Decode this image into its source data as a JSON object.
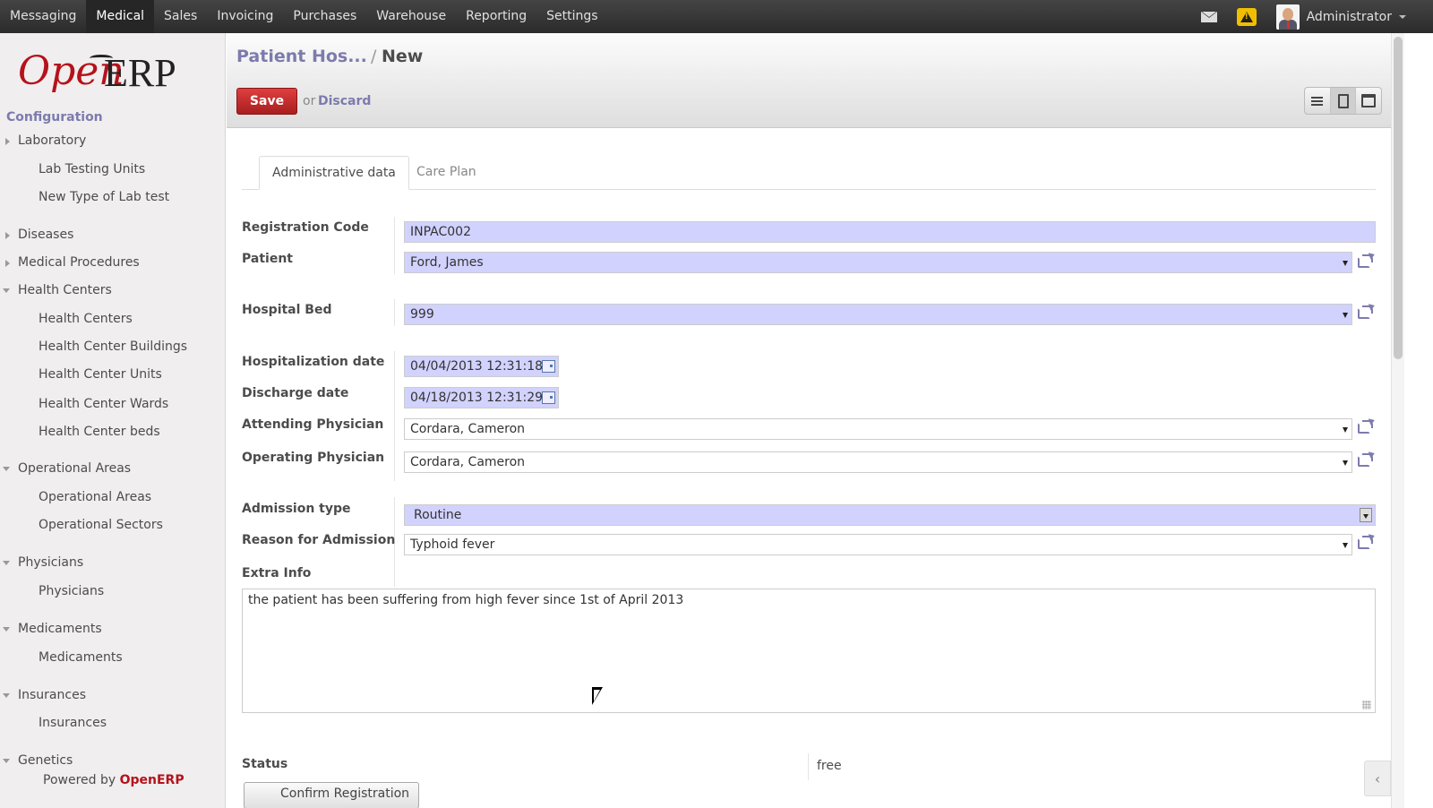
{
  "topmenu": {
    "items": [
      "Messaging",
      "Medical",
      "Sales",
      "Invoicing",
      "Purchases",
      "Warehouse",
      "Reporting",
      "Settings"
    ],
    "active": "Medical",
    "user": "Administrator"
  },
  "logo": {
    "part1": "Open",
    "part2": "ERP"
  },
  "sidebar": {
    "section": "Configuration",
    "items": [
      {
        "label": "Laboratory",
        "level": 1,
        "arrow": "right"
      },
      {
        "label": "Lab Testing Units",
        "level": 2
      },
      {
        "label": "New Type of Lab test",
        "level": 2
      },
      {
        "label": "Diseases",
        "level": 1,
        "arrow": "right"
      },
      {
        "label": "Medical Procedures",
        "level": 1,
        "arrow": "right"
      },
      {
        "label": "Health Centers",
        "level": 1,
        "arrow": "down"
      },
      {
        "label": "Health Centers",
        "level": 2
      },
      {
        "label": "Health Center Buildings",
        "level": 2
      },
      {
        "label": "Health Center Units",
        "level": 2
      },
      {
        "label": "Health Center Wards",
        "level": 2
      },
      {
        "label": "Health Center beds",
        "level": 2
      },
      {
        "label": "Operational Areas",
        "level": 1,
        "arrow": "down"
      },
      {
        "label": "Operational Areas",
        "level": 2
      },
      {
        "label": "Operational Sectors",
        "level": 2
      },
      {
        "label": "Physicians",
        "level": 1,
        "arrow": "down"
      },
      {
        "label": "Physicians",
        "level": 2
      },
      {
        "label": "Medicaments",
        "level": 1,
        "arrow": "down"
      },
      {
        "label": "Medicaments",
        "level": 2
      },
      {
        "label": "Insurances",
        "level": 1,
        "arrow": "down"
      },
      {
        "label": "Insurances",
        "level": 2
      },
      {
        "label": "Genetics",
        "level": 1,
        "arrow": "down"
      }
    ],
    "powered_prefix": "Powered by",
    "powered_brand": "OpenERP"
  },
  "cpanel": {
    "breadcrumb_parent": "Patient Hos...",
    "breadcrumb_sep": "/",
    "breadcrumb_current": "New",
    "save_label": "Save",
    "or_text": "or",
    "discard_label": "Discard"
  },
  "tabs": [
    "Administrative data",
    "Care Plan"
  ],
  "form": {
    "registration_code": {
      "label": "Registration Code",
      "value": "INPAC002"
    },
    "patient": {
      "label": "Patient",
      "value": "Ford, James"
    },
    "hospital_bed": {
      "label": "Hospital Bed",
      "value": "999"
    },
    "hospitalization_date": {
      "label": "Hospitalization date",
      "value": "04/04/2013 12:31:18"
    },
    "discharge_date": {
      "label": "Discharge date",
      "value": "04/18/2013 12:31:29"
    },
    "attending_physician": {
      "label": "Attending Physician",
      "value": "Cordara, Cameron"
    },
    "operating_physician": {
      "label": "Operating Physician",
      "value": "Cordara, Cameron"
    },
    "admission_type": {
      "label": "Admission type",
      "value": "Routine"
    },
    "reason_for_admission": {
      "label": "Reason for Admission",
      "value": "Typhoid fever"
    },
    "extra_info": {
      "label": "Extra Info",
      "value": "the patient has been suffering from high fever since 1st of April 2013"
    },
    "status": {
      "label": "Status",
      "value": "free"
    },
    "confirm_button": "Confirm Registration"
  },
  "colors": {
    "accent": "#7c7bad",
    "brand_red": "#b5121b",
    "required_field": "#d2d2ff",
    "topbar": "#3b3b3b"
  }
}
